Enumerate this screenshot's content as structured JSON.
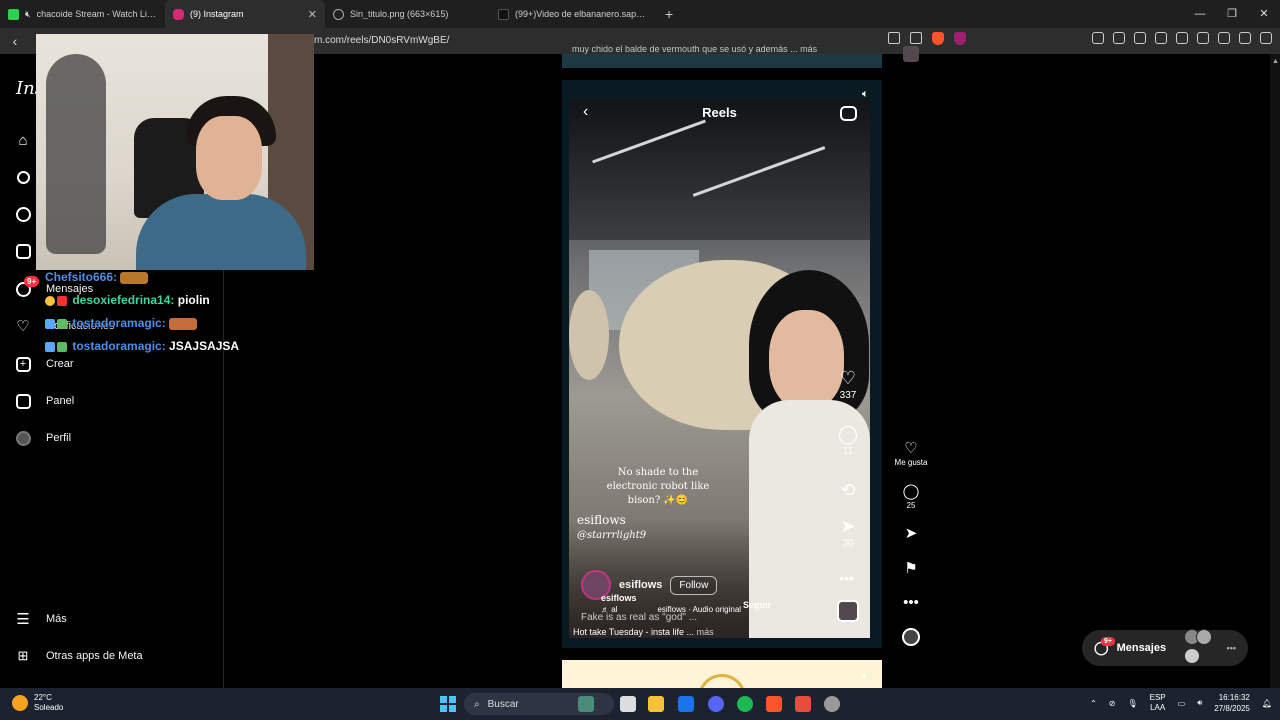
{
  "browser": {
    "tabs": [
      {
        "title": "chacoide Stream - Watch Live on",
        "favicon_color": "#2bd150"
      },
      {
        "title": "(9) Instagram",
        "favicon_color": "#d62976",
        "active": true
      },
      {
        "title": "Sin_titulo.png (663×615)",
        "favicon_color": "#9aa0a6"
      },
      {
        "title": "(99+)Video de elbananero.sapee (@e",
        "favicon_color": "#111111"
      }
    ],
    "new_tab": "+",
    "url": "m.com/reels/DN0sRVmWgBE/",
    "back": "‹"
  },
  "sidebar": {
    "logo": "Ins",
    "items": [
      {
        "label": "",
        "icon": "home-icon"
      },
      {
        "label": "",
        "icon": "search-icon"
      },
      {
        "label": "",
        "icon": "explore-icon"
      },
      {
        "label": "",
        "icon": "reels-icon"
      },
      {
        "label": "Mensajes",
        "icon": "messenger-icon"
      },
      {
        "label": "Notificaciones",
        "icon": "heart-icon"
      },
      {
        "label": "Crear",
        "icon": "plus-icon"
      },
      {
        "label": "Panel",
        "icon": "dashboard-icon"
      },
      {
        "label": "Perfil",
        "icon": "profile-icon"
      },
      {
        "label": "Más",
        "icon": "menu-icon"
      },
      {
        "label": "Otras apps de Meta",
        "icon": "meta-apps-icon"
      }
    ],
    "messages_badge": "9+"
  },
  "chat": [
    {
      "user": "Chefsito666:",
      "msg": "",
      "emote": true
    },
    {
      "user": "desoxiefedrina14:",
      "msg": "piolin",
      "green": true
    },
    {
      "user": "tostadoramagic:",
      "msg": "",
      "emote": true
    },
    {
      "user": "tostadoramagic:",
      "msg": "JSAJSAJSA"
    }
  ],
  "feed_prev_caption": "muy chido el balde de vermouth que se usó y además ... más",
  "reel": {
    "header": "Reels",
    "caption_lines": [
      "No shade to the",
      "electronic robot like",
      "bison? ✨😊"
    ],
    "watermark": "esiflows",
    "watermark_sub": "@starrrlight9",
    "likes": "337",
    "comments": "11",
    "shares": "30",
    "username": "esiflows",
    "follow": "Follow",
    "overlay_user": "esiflows",
    "audio_left": "♬ al",
    "audio_label": "esiflows · Audio original",
    "seguir": "Seguir",
    "fake_line": "Fake is as real as \"god\" ...",
    "hot_take": "Hot take Tuesday - insta life ...",
    "mas": "más"
  },
  "side_actions": {
    "like_label": "Me gusta",
    "comments": "25"
  },
  "messages_pill": {
    "label": "Mensajes",
    "badge": "9+"
  },
  "taskbar": {
    "temp": "22°C",
    "weather": "Soleado",
    "search": "Buscar",
    "lang_top": "ESP",
    "lang_bottom": "LAA",
    "time": "16:16:32",
    "date": "27/8/2025"
  }
}
